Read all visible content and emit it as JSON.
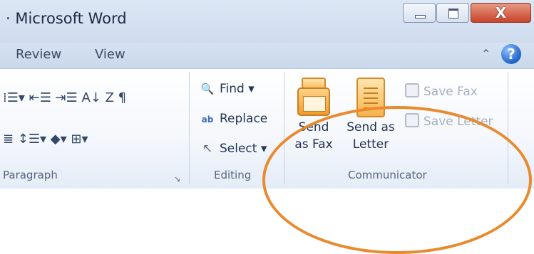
{
  "window": {
    "title": "· Microsoft Word",
    "minimize_glyph": "",
    "maximize_glyph": "",
    "close_glyph": "X"
  },
  "tabs": {
    "review": "Review",
    "view": "View",
    "collapse_glyph": "⌃",
    "help_glyph": "?"
  },
  "paragraph": {
    "row1": "⁞☰▾  ⇤☰ ⇥☰  A↓ Z  ¶",
    "row2": "≣  ↕☰▾  ◆▾  ⊞▾",
    "label": "Paragraph",
    "launcher_glyph": "↘"
  },
  "editing": {
    "find": "Find ▾",
    "replace": "Replace",
    "select": "Select ▾",
    "label": "Editing",
    "find_icon": "🔍",
    "replace_icon": "ab",
    "select_icon": "↖"
  },
  "communicator": {
    "send_fax_line1": "Send",
    "send_fax_line2": "as Fax",
    "send_letter_line1": "Send as",
    "send_letter_line2": "Letter",
    "save_fax": "Save Fax",
    "save_letter": "Save Letter",
    "label": "Communicator"
  },
  "colors": {
    "highlight_ellipse": "#e88a2d",
    "accent": "#1f62c7"
  }
}
